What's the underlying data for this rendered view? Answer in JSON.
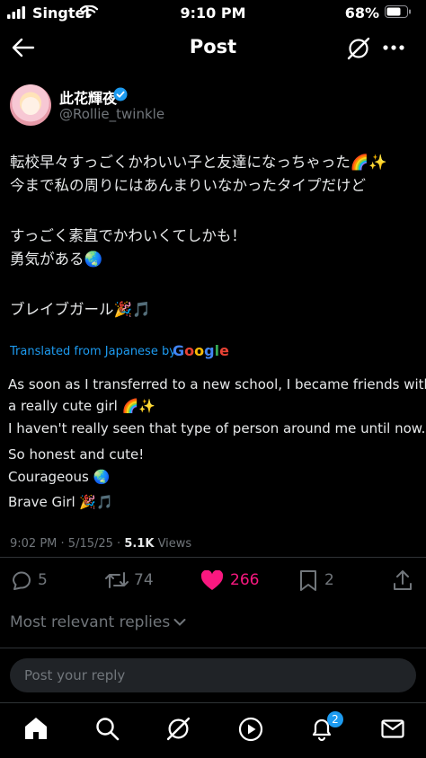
{
  "status_bar": {
    "carrier": "Singtel",
    "time": "9:10 PM",
    "battery": "68%"
  },
  "header": {
    "title": "Post"
  },
  "author": {
    "name": "此花輝夜",
    "handle": "@Rollie_twinkle",
    "verified": true
  },
  "post": {
    "original_lines": [
      "転校早々すっごくかわいい子と友達になっちゃった🌈✨",
      "今まで私の周りにはあんまりいなかったタイプだけど",
      "すっごく素直でかわいくてしかも！",
      "勇気がある🌏",
      "ブレイブガール🎉🎵"
    ],
    "translated_from": "Translated from Japanese by",
    "translator": "Google",
    "translation_lines": [
      "As soon as I transferred to a new school, I became friends with",
      "a really cute girl 🌈✨",
      "I haven't really seen that type of person around me until now.",
      "So honest and cute!",
      "Courageous 🌏",
      "Brave Girl 🎉🎵"
    ]
  },
  "meta": {
    "time": "9:02 PM",
    "date": "5/15/25",
    "views_count": "5.1K",
    "views_label": "Views"
  },
  "actions": {
    "replies": "5",
    "reposts": "74",
    "likes": "266",
    "bookmarks": "2"
  },
  "replies_sort": {
    "label": "Most relevant replies"
  },
  "reply_input": {
    "placeholder": "Post your reply"
  },
  "tabbar": {
    "notifications_badge": "2"
  },
  "colors": {
    "accent": "#1d9bf0",
    "like": "#f91880",
    "muted": "#71767b",
    "background": "#000000"
  }
}
